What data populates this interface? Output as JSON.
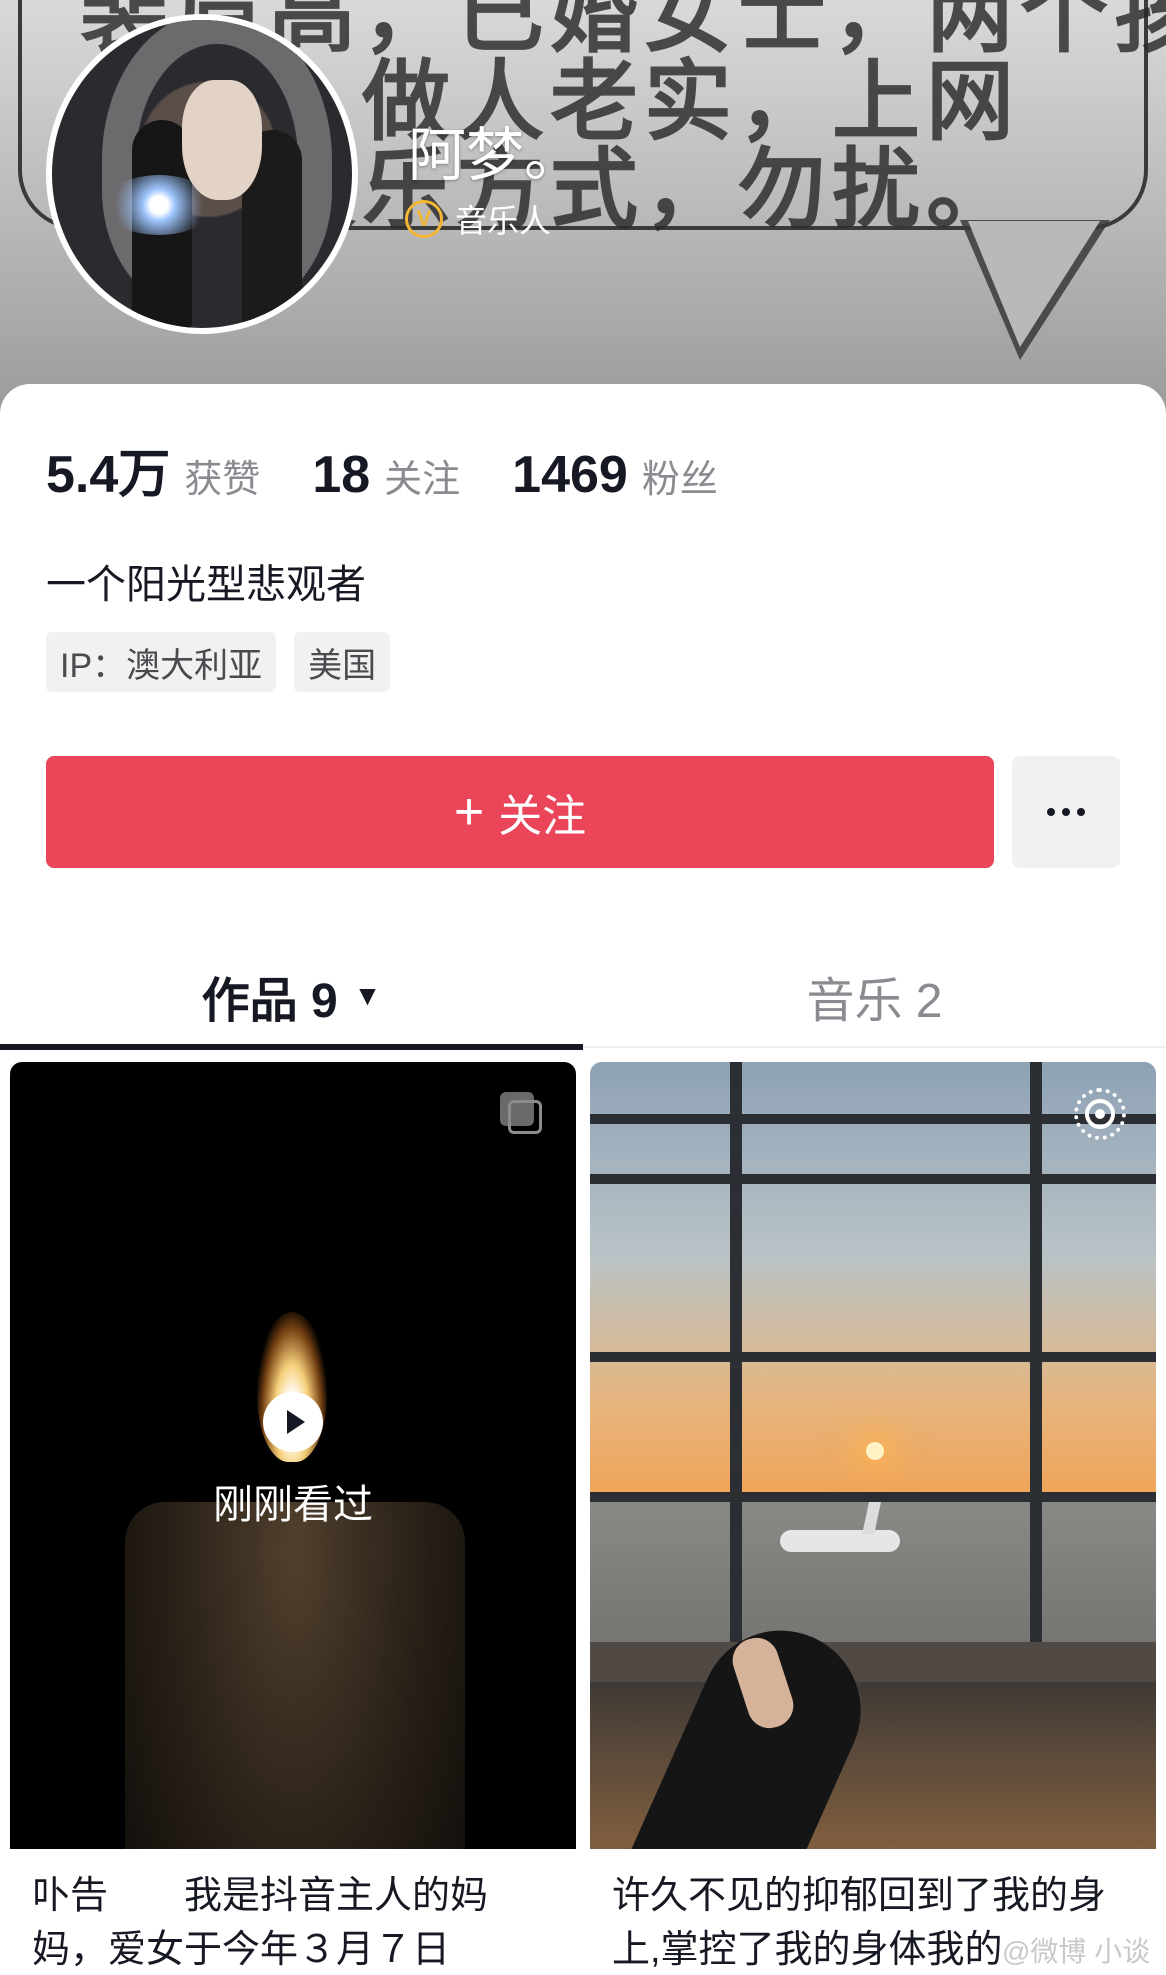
{
  "banner": {
    "text_lines": [
      "裴眉高，已婚女士，两个孩",
      "母亲，做人老实，上网",
      "一种娱乐方式，勿扰。"
    ]
  },
  "profile": {
    "nickname": "阿梦。",
    "verify_label": "音乐人",
    "verify_icon": "v-badge-icon"
  },
  "stats": [
    {
      "value": "5.4万",
      "label": "获赞"
    },
    {
      "value": "18",
      "label": "关注"
    },
    {
      "value": "1469",
      "label": "粉丝"
    }
  ],
  "bio": "一个阳光型悲观者",
  "tags": [
    "IP：澳大利亚",
    "美国"
  ],
  "actions": {
    "follow_plus": "+",
    "follow_label": "关注",
    "more_icon": "more-dots-icon"
  },
  "tabs": [
    {
      "label": "作品 9",
      "caret": "▼",
      "active": true
    },
    {
      "label": "音乐 2",
      "active": false
    }
  ],
  "posts": [
    {
      "overlay": "刚刚看过",
      "caption": "卟告　　我是抖音主人的妈妈，爱女于今年３月７日"
    },
    {
      "caption": "许久不见的抑郁回到了我的身上,掌控了我的身体我的"
    }
  ],
  "watermark": "@微博 小谈",
  "colors": {
    "accent": "#ea4559",
    "text": "#161823",
    "muted": "#8a8b91",
    "verify": "#f5b731"
  }
}
